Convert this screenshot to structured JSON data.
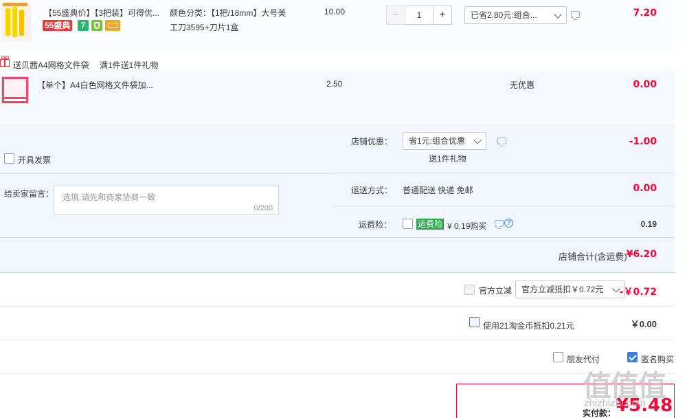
{
  "item1": {
    "title": "【55盛典价】【3把装】可得优...",
    "badge_55": "55盛典",
    "badge_7": "7",
    "sku_line1": "颜色分类：【1把/18mm】大号美",
    "sku_line2": "工刀3595+刀片1盒",
    "unit_price": "10.00",
    "quantity": "1",
    "minus_label": "−",
    "plus_label": "+",
    "discount_select": "已省2.80元:组合...",
    "subtotal": "7.20"
  },
  "gift_banner": {
    "text1": "送贝茜A4网格文件袋",
    "text2": "满1件送1件礼物"
  },
  "item2": {
    "title": "【单个】A4白色网格文件袋加...",
    "unit_price": "2.50",
    "promo": "无优惠",
    "subtotal": "0.00"
  },
  "shop": {
    "invoice_label": "开具发票",
    "shop_discount_label": "店铺优惠：",
    "shop_discount_select": "省1元:组合优惠",
    "gift_note": "送1件礼物",
    "shop_discount_value": "-1.00",
    "message_label": "给卖家留言：",
    "message_placeholder": "选填,请先和商家协商一致",
    "message_counter": "0/200",
    "shipping_label": "运送方式：",
    "shipping_method": "普通配送 快递 免邮",
    "shipping_value": "0.00",
    "insurance_label": "运费险：",
    "insurance_badge": "运费险",
    "insurance_price": "¥ 0.19购买",
    "insurance_value": "0.19",
    "total_label": "店铺合计(含运费)",
    "total_value": "¥6.20"
  },
  "official": {
    "label": "官方立减",
    "select": "官方立减抵扣￥0.72元",
    "value": "-￥0.72"
  },
  "coins": {
    "label": "使用21淘金币抵扣0.21元",
    "value": "￥0.00"
  },
  "options": {
    "friend_pay": "朋友代付",
    "anonymous": "匿名购买"
  },
  "pay": {
    "label": "实付款：",
    "value": "¥5.48"
  },
  "watermark": {
    "text": "值值值",
    "url": "zhizhizhi.com"
  },
  "colors": {
    "accent_red": "#ff0036",
    "link_blue": "#3b7de0",
    "badge_pink": "#e4393c",
    "badge_green": "#2bb673"
  }
}
